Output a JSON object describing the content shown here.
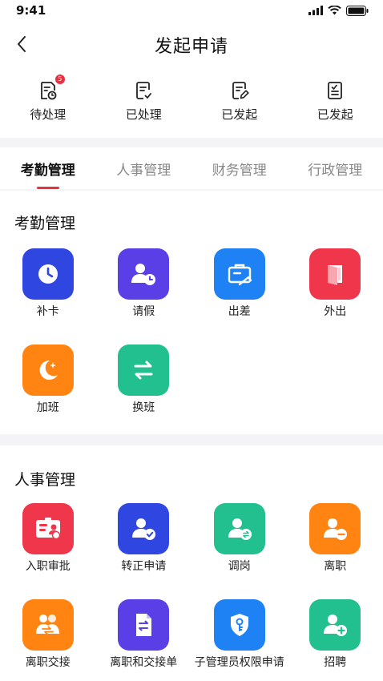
{
  "status_bar": {
    "time": "9:41"
  },
  "header": {
    "title": "发起申请"
  },
  "quick_actions": [
    {
      "label": "待处理",
      "badge": "5",
      "icon": "pending-doc-icon"
    },
    {
      "label": "已处理",
      "icon": "processed-doc-icon"
    },
    {
      "label": "已发起",
      "icon": "initiated-doc-icon"
    },
    {
      "label": "已发起",
      "icon": "initiated-list-icon"
    }
  ],
  "tabs": [
    {
      "label": "考勤管理",
      "active": true
    },
    {
      "label": "人事管理"
    },
    {
      "label": "财务管理"
    },
    {
      "label": "行政管理"
    }
  ],
  "attendance": {
    "title": "考勤管理",
    "items": [
      {
        "label": "补卡",
        "icon": "clock-icon",
        "color": "#2f46e0"
      },
      {
        "label": "请假",
        "icon": "person-clock-icon",
        "color": "#5a3ee6"
      },
      {
        "label": "出差",
        "icon": "briefcase-icon",
        "color": "#1e82f5"
      },
      {
        "label": "外出",
        "icon": "door-icon",
        "color": "#f0364a"
      },
      {
        "label": "加班",
        "icon": "moon-icon",
        "color": "#ff8412"
      },
      {
        "label": "换班",
        "icon": "swap-icon",
        "color": "#22c08e"
      }
    ]
  },
  "hr": {
    "title": "人事管理",
    "items": [
      {
        "label": "入职审批",
        "icon": "id-card-icon",
        "color": "#f0364a"
      },
      {
        "label": "转正申请",
        "icon": "person-check-icon",
        "color": "#2f46e0"
      },
      {
        "label": "调岗",
        "icon": "person-transfer-icon",
        "color": "#22c08e"
      },
      {
        "label": "离职",
        "icon": "person-minus-icon",
        "color": "#ff8412"
      },
      {
        "label": "离职交接",
        "icon": "handover-icon",
        "color": "#ff8412"
      },
      {
        "label": "离职和交接单",
        "icon": "exchange-doc-icon",
        "color": "#5a3ee6"
      },
      {
        "label": "子管理员权限申请",
        "icon": "shield-key-icon",
        "color": "#1e82f5"
      },
      {
        "label": "招聘",
        "icon": "person-add-icon",
        "color": "#22c08e"
      }
    ]
  }
}
